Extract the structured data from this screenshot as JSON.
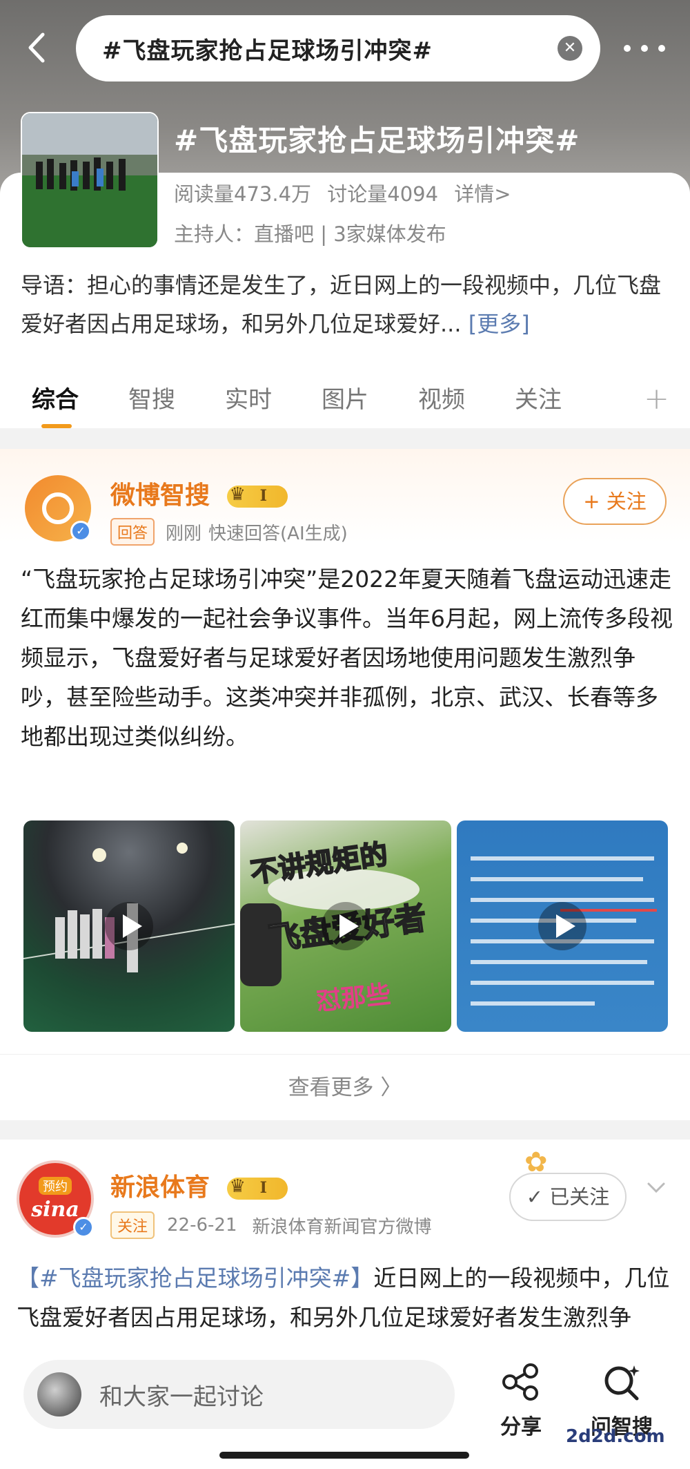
{
  "header": {
    "search_query": "#飞盘玩家抢占足球场引冲突#"
  },
  "topic": {
    "title": "#飞盘玩家抢占足球场引冲突#",
    "reads": "阅读量473.4万",
    "discussions": "讨论量4094",
    "details": "详情>",
    "host": "主持人：直播吧 | 3家媒体发布",
    "intro": "导语：担心的事情还是发生了，近日网上的一段视频中，几位飞盘爱好者因占用足球场，和另外几位足球爱好...",
    "more": "[更多]"
  },
  "tabs": [
    "综合",
    "智搜",
    "实时",
    "图片",
    "视频",
    "关注"
  ],
  "card1": {
    "name": "微博智搜",
    "tag": "回答",
    "time": "刚刚",
    "source": "快速回答(AI生成)",
    "follow": "+ 关注",
    "body": "“飞盘玩家抢占足球场引冲突”是2022年夏天随着飞盘运动迅速走红而集中爆发的一起社会争议事件。当年6月起，网上流传多段视频显示，飞盘爱好者与足球爱好者因场地使用问题发生激烈争吵，甚至险些动手。这类冲突并非孤例，北京、武汉、长春等多地都出现过类似纠纷。",
    "media2_line1": "不讲规矩的",
    "media2_line2": "飞盘爱好者",
    "media2_line3": "怼那些",
    "see_more": "查看更多 〉"
  },
  "card2": {
    "avatar_tag": "预约",
    "avatar_logo": "sina",
    "name": "新浪体育",
    "tag": "关注",
    "date": "22-6-21",
    "source": "新浪体育新闻官方微博",
    "followed": "✓ 已关注",
    "hashtag": "【#飞盘玩家抢占足球场引冲突#】",
    "body": "近日网上的一段视频中，几位飞盘爱好者因占用足球场，和另外几位足球爱好者发生激烈争吵，双方险些动手。这事大家怎么看？"
  },
  "bottom": {
    "discuss": "和大家一起讨论",
    "share": "分享",
    "ask": "问智搜"
  },
  "watermark": "2d2d.com",
  "colors": {
    "accent": "#e8791c",
    "link": "#5b7bb0",
    "tab_indicator": "#f29a1b"
  }
}
